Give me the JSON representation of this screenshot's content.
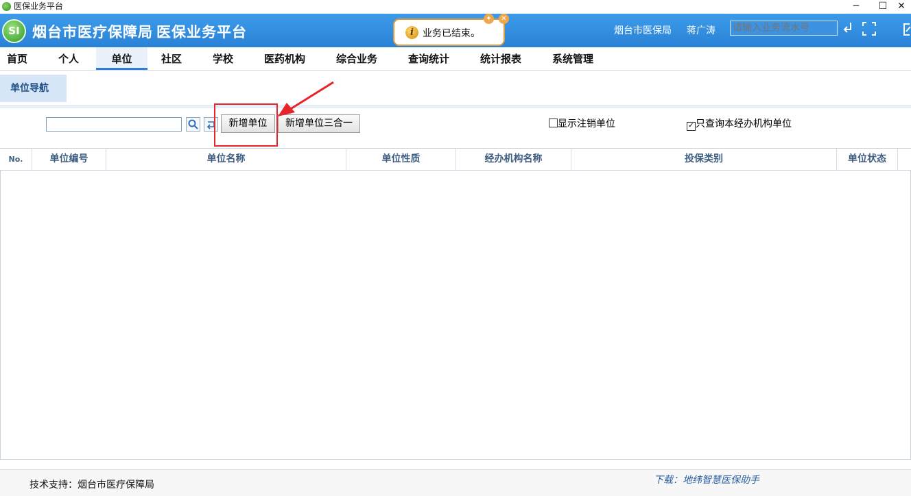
{
  "window": {
    "title": "医保业务平台",
    "minimize": "─",
    "maximize": "☐",
    "close": "✕"
  },
  "header": {
    "logo_text": "SI",
    "org_title": "烟台市医疗保障局",
    "app_title": "医保业务平台",
    "org": "烟台市医保局",
    "user": "蒋广涛",
    "search_placeholder": "请输入业务流水号",
    "icons": [
      "return-icon",
      "fullscreen-icon",
      "external-icon"
    ]
  },
  "toast": {
    "message": "业务已结束。",
    "icon": "info-icon"
  },
  "menu": {
    "items": [
      {
        "label": "首页"
      },
      {
        "label": "个人"
      },
      {
        "label": "单位",
        "active": true
      },
      {
        "label": "社区"
      },
      {
        "label": "学校"
      },
      {
        "label": "医药机构"
      },
      {
        "label": "综合业务"
      },
      {
        "label": "查询统计"
      },
      {
        "label": "统计报表"
      },
      {
        "label": "系统管理"
      }
    ]
  },
  "subnav": {
    "label": "单位导航"
  },
  "toolbar": {
    "keyword_value": "",
    "add_unit": "新增单位",
    "add_unit_three_in_one": "新增单位三合一",
    "show_cancelled": {
      "label": "显示注销单位",
      "checked": false
    },
    "only_this_agency": {
      "label": "只查询本经办机构单位",
      "checked": true
    }
  },
  "table": {
    "columns": [
      "No.",
      "单位编号",
      "单位名称",
      "单位性质",
      "经办机构名称",
      "投保类别",
      "单位状态"
    ],
    "rows": []
  },
  "footer": {
    "support": "技术支持：烟台市医疗保障局",
    "download": "下载：地纬智慧医保助手"
  },
  "colors": {
    "header_blue": "#2a82d6",
    "toast_border": "#e59a3a",
    "annotation_red": "#e6242a"
  }
}
